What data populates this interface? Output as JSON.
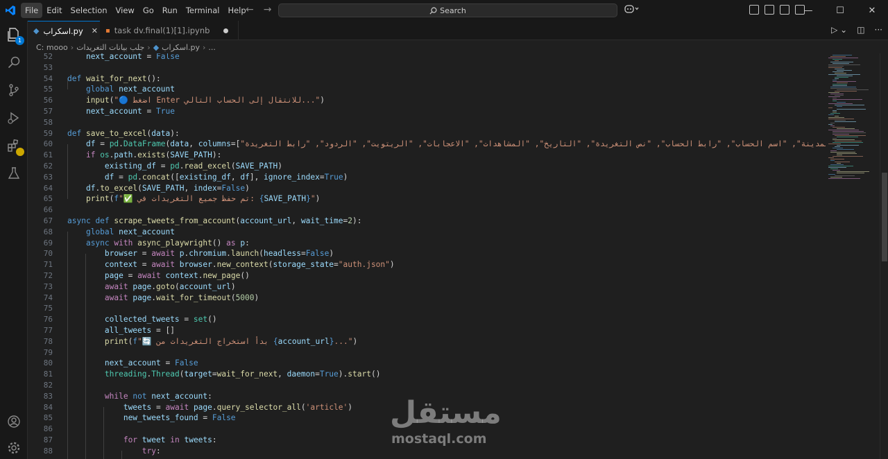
{
  "menu": [
    "File",
    "Edit",
    "Selection",
    "View",
    "Go",
    "Run",
    "Terminal",
    "Help"
  ],
  "search": {
    "label": "Search"
  },
  "badges": {
    "explorer": "1"
  },
  "tabs": [
    {
      "label": "اسكراب.py",
      "active": true
    },
    {
      "label": "task dv.final(1)[1].ipynb",
      "active": false,
      "modified": true
    }
  ],
  "breadcrumb": [
    "C: mooo",
    "جلب بيانات التغريدات",
    "اسكراب.py",
    "..."
  ],
  "code_lines": [
    {
      "n": "52",
      "html": "    <span class='var'>next_account</span> <span class='txt'>=</span> <span class='kw'>False</span>"
    },
    {
      "n": "53",
      "html": ""
    },
    {
      "n": "54",
      "html": "<span class='kw'>def</span> <span class='fn'>wait_for_next</span><span class='txt'>():</span>"
    },
    {
      "n": "55",
      "html": "    <span class='kw'>global</span> <span class='var'>next_account</span>"
    },
    {
      "n": "56",
      "html": "    <span class='fn'>input</span><span class='txt'>(</span><span class='str'>\"🔵 اضغط Enter للانتقال إلى الحساب التالي...\"</span><span class='txt'>)</span>"
    },
    {
      "n": "57",
      "html": "    <span class='var'>next_account</span> <span class='txt'>=</span> <span class='kw'>True</span>"
    },
    {
      "n": "58",
      "html": ""
    },
    {
      "n": "59",
      "html": "<span class='kw'>def</span> <span class='fn'>save_to_excel</span><span class='txt'>(</span><span class='var'>data</span><span class='txt'>):</span>"
    },
    {
      "n": "60",
      "html": "    <span class='var'>df</span> <span class='txt'>=</span> <span class='cls'>pd</span><span class='txt'>.</span><span class='cls'>DataFrame</span><span class='txt'>(</span><span class='var'>data</span><span class='txt'>, </span><span class='var'>columns</span><span class='txt'>=[</span><span class='str'>\"اسم المدينة\", \"اسم الحساب\", \"رابط الحساب\", \"نص التغريدة\", \"التاريخ\", \"المشاهدات\", \"الاعجابات\", \"الريتويت\", \"الردود\", \"رابط التغريدة\"</span>"
    },
    {
      "n": "61",
      "html": "    <span class='kw2'>if</span> <span class='cls'>os</span><span class='txt'>.</span><span class='var'>path</span><span class='txt'>.</span><span class='fn'>exists</span><span class='txt'>(</span><span class='var'>SAVE_PATH</span><span class='txt'>):</span>"
    },
    {
      "n": "62",
      "html": "        <span class='var'>existing_df</span> <span class='txt'>=</span> <span class='cls'>pd</span><span class='txt'>.</span><span class='fn'>read_excel</span><span class='txt'>(</span><span class='var'>SAVE_PATH</span><span class='txt'>)</span>"
    },
    {
      "n": "63",
      "html": "        <span class='var'>df</span> <span class='txt'>=</span> <span class='cls'>pd</span><span class='txt'>.</span><span class='fn'>concat</span><span class='txt'>([</span><span class='var'>existing_df</span><span class='txt'>, </span><span class='var'>df</span><span class='txt'>], </span><span class='var'>ignore_index</span><span class='txt'>=</span><span class='kw'>True</span><span class='txt'>)</span>"
    },
    {
      "n": "64",
      "html": "    <span class='var'>df</span><span class='txt'>.</span><span class='fn'>to_excel</span><span class='txt'>(</span><span class='var'>SAVE_PATH</span><span class='txt'>, </span><span class='var'>index</span><span class='txt'>=</span><span class='kw'>False</span><span class='txt'>)</span>"
    },
    {
      "n": "65",
      "html": "    <span class='fn'>print</span><span class='txt'>(</span><span class='kw'>f</span><span class='str'>\"✅ تم حفظ جميع التغريدات في: </span><span class='kw'>{</span><span class='var'>SAVE_PATH</span><span class='kw'>}</span><span class='str'>\"</span><span class='txt'>)</span>"
    },
    {
      "n": "66",
      "html": ""
    },
    {
      "n": "67",
      "html": "<span class='kw'>async</span> <span class='kw'>def</span> <span class='fn'>scrape_tweets_from_account</span><span class='txt'>(</span><span class='var'>account_url</span><span class='txt'>, </span><span class='var'>wait_time</span><span class='txt'>=</span><span class='num'>2</span><span class='txt'>):</span>"
    },
    {
      "n": "68",
      "html": "    <span class='kw'>global</span> <span class='var'>next_account</span>"
    },
    {
      "n": "69",
      "html": "    <span class='kw'>async</span> <span class='kw2'>with</span> <span class='fn'>async_playwright</span><span class='txt'>() </span><span class='kw2'>as</span> <span class='var'>p</span><span class='txt'>:</span>"
    },
    {
      "n": "70",
      "html": "        <span class='var'>browser</span> <span class='txt'>=</span> <span class='kw2'>await</span> <span class='var'>p</span><span class='txt'>.</span><span class='var'>chromium</span><span class='txt'>.</span><span class='fn'>launch</span><span class='txt'>(</span><span class='var'>headless</span><span class='txt'>=</span><span class='kw'>False</span><span class='txt'>)</span>"
    },
    {
      "n": "71",
      "html": "        <span class='var'>context</span> <span class='txt'>=</span> <span class='kw2'>await</span> <span class='var'>browser</span><span class='txt'>.</span><span class='fn'>new_context</span><span class='txt'>(</span><span class='var'>storage_state</span><span class='txt'>=</span><span class='str'>\"auth.json\"</span><span class='txt'>)</span>"
    },
    {
      "n": "72",
      "html": "        <span class='var'>page</span> <span class='txt'>=</span> <span class='kw2'>await</span> <span class='var'>context</span><span class='txt'>.</span><span class='fn'>new_page</span><span class='txt'>()</span>"
    },
    {
      "n": "73",
      "html": "        <span class='kw2'>await</span> <span class='var'>page</span><span class='txt'>.</span><span class='fn'>goto</span><span class='txt'>(</span><span class='var'>account_url</span><span class='txt'>)</span>"
    },
    {
      "n": "74",
      "html": "        <span class='kw2'>await</span> <span class='var'>page</span><span class='txt'>.</span><span class='fn'>wait_for_timeout</span><span class='txt'>(</span><span class='num'>5000</span><span class='txt'>)</span>"
    },
    {
      "n": "75",
      "html": ""
    },
    {
      "n": "76",
      "html": "        <span class='var'>collected_tweets</span> <span class='txt'>=</span> <span class='cls'>set</span><span class='txt'>()</span>"
    },
    {
      "n": "77",
      "html": "        <span class='var'>all_tweets</span> <span class='txt'>=</span> <span class='txt'>[]</span>"
    },
    {
      "n": "78",
      "html": "        <span class='fn'>print</span><span class='txt'>(</span><span class='kw'>f</span><span class='str'>\"🔄 بدأ استخراج التغريدات من </span><span class='kw'>{</span><span class='var'>account_url</span><span class='kw'>}</span><span class='str'>...\"</span><span class='txt'>)</span>"
    },
    {
      "n": "79",
      "html": ""
    },
    {
      "n": "80",
      "html": "        <span class='var'>next_account</span> <span class='txt'>=</span> <span class='kw'>False</span>"
    },
    {
      "n": "81",
      "html": "        <span class='cls'>threading</span><span class='txt'>.</span><span class='cls'>Thread</span><span class='txt'>(</span><span class='var'>target</span><span class='txt'>=</span><span class='fn'>wait_for_next</span><span class='txt'>, </span><span class='var'>daemon</span><span class='txt'>=</span><span class='kw'>True</span><span class='txt'>).</span><span class='fn'>start</span><span class='txt'>()</span>"
    },
    {
      "n": "82",
      "html": ""
    },
    {
      "n": "83",
      "html": "        <span class='kw2'>while</span> <span class='kw'>not</span> <span class='var'>next_account</span><span class='txt'>:</span>"
    },
    {
      "n": "84",
      "html": "            <span class='var'>tweets</span> <span class='txt'>=</span> <span class='kw2'>await</span> <span class='var'>page</span><span class='txt'>.</span><span class='fn'>query_selector_all</span><span class='txt'>(</span><span class='str'>'article'</span><span class='txt'>)</span>"
    },
    {
      "n": "85",
      "html": "            <span class='var'>new_tweets_found</span> <span class='txt'>=</span> <span class='kw'>False</span>"
    },
    {
      "n": "86",
      "html": ""
    },
    {
      "n": "87",
      "html": "            <span class='kw2'>for</span> <span class='var'>tweet</span> <span class='kw2'>in</span> <span class='var'>tweets</span><span class='txt'>:</span>"
    },
    {
      "n": "88",
      "html": "                <span class='kw2'>try</span><span class='txt'>:</span>"
    }
  ],
  "watermark": {
    "arabic": "مستقل",
    "latin": "mostaql.com"
  }
}
